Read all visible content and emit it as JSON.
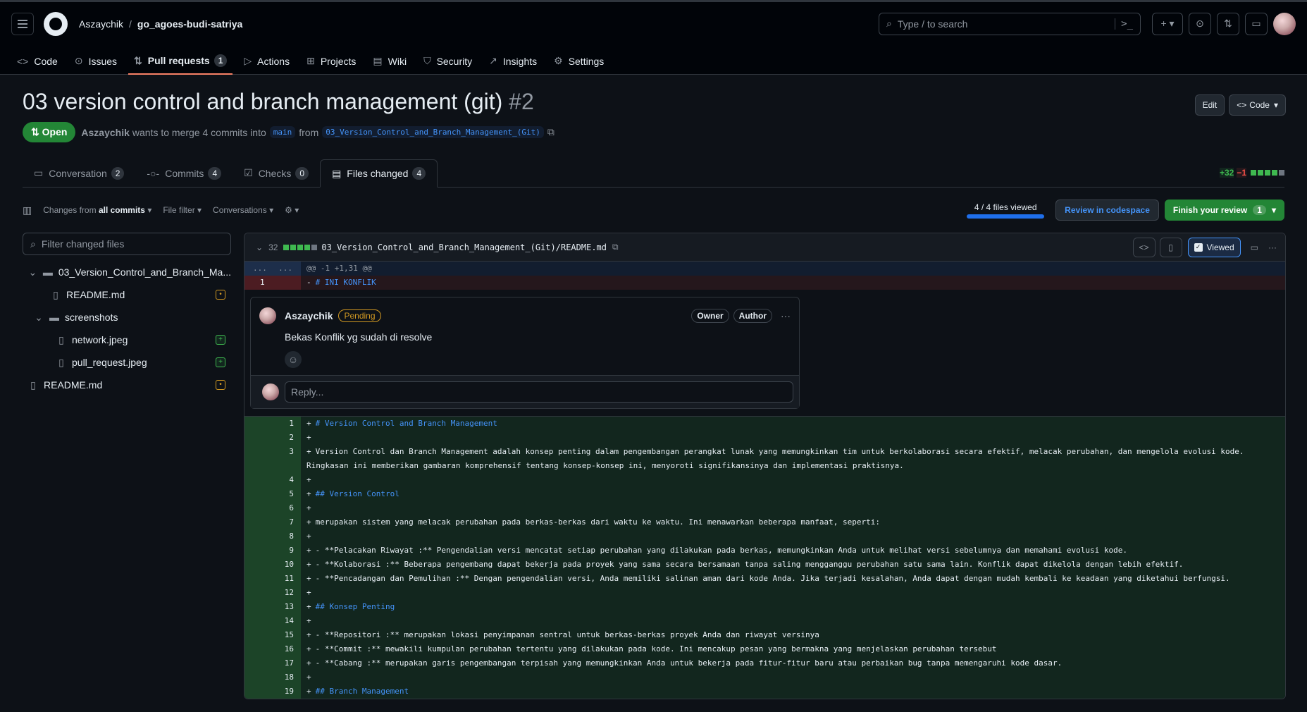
{
  "header": {
    "owner": "Aszaychik",
    "repo": "go_agoes-budi-satriya",
    "search_placeholder": "Type / to search",
    "search_cmd": ">_"
  },
  "repo_tabs": [
    {
      "label": "Code",
      "icon": "<>",
      "count": null
    },
    {
      "label": "Issues",
      "icon": "⊙",
      "count": null
    },
    {
      "label": "Pull requests",
      "icon": "⇅",
      "count": "1"
    },
    {
      "label": "Actions",
      "icon": "▷",
      "count": null
    },
    {
      "label": "Projects",
      "icon": "⊞",
      "count": null
    },
    {
      "label": "Wiki",
      "icon": "▤",
      "count": null
    },
    {
      "label": "Security",
      "icon": "⛉",
      "count": null
    },
    {
      "label": "Insights",
      "icon": "↗",
      "count": null
    },
    {
      "label": "Settings",
      "icon": "⚙",
      "count": null
    }
  ],
  "pr": {
    "title": "03 version control and branch management (git)",
    "number": "#2",
    "state": "Open",
    "author": "Aszaychik",
    "merge_text": "wants to merge 4 commits into",
    "base": "main",
    "from_text": "from",
    "head": "03_Version_Control_and_Branch_Management_(Git)",
    "edit_label": "Edit",
    "code_label": "Code"
  },
  "pr_tabs": [
    {
      "label": "Conversation",
      "count": "2"
    },
    {
      "label": "Commits",
      "count": "4"
    },
    {
      "label": "Checks",
      "count": "0"
    },
    {
      "label": "Files changed",
      "count": "4"
    }
  ],
  "diffstat": {
    "additions": "+32",
    "deletions": "−1"
  },
  "toolbar": {
    "changes_prefix": "Changes from",
    "changes_value": "all commits",
    "file_filter": "File filter",
    "conversations": "Conversations",
    "viewed": "4 / 4 files viewed",
    "review_codespace": "Review in codespace",
    "finish_review": "Finish your review",
    "finish_count": "1"
  },
  "sidebar": {
    "filter_placeholder": "Filter changed files",
    "tree": [
      {
        "name": "03_Version_Control_and_Branch_Ma...",
        "type": "folder",
        "status": null
      },
      {
        "name": "README.md",
        "type": "file",
        "status": "modified"
      },
      {
        "name": "screenshots",
        "type": "folder",
        "status": null
      },
      {
        "name": "network.jpeg",
        "type": "file",
        "status": "added"
      },
      {
        "name": "pull_request.jpeg",
        "type": "file",
        "status": "added"
      },
      {
        "name": "README.md",
        "type": "file",
        "status": "modified"
      }
    ]
  },
  "file": {
    "changes": "32",
    "path": "03_Version_Control_and_Branch_Management_(Git)/README.md",
    "viewed_label": "Viewed",
    "hunk_left": "...",
    "hunk_right": "...",
    "hunk": "@@ -1 +1,31 @@",
    "deleted_line_num": "1",
    "deleted_line": "# INI KONFLIK"
  },
  "comment": {
    "author": "Aszaychik",
    "badge": "Pending",
    "owner_label": "Owner",
    "author_label": "Author",
    "text": "Bekas Konflik yg sudah di resolve",
    "reply_placeholder": "Reply..."
  },
  "added_lines": [
    {
      "n": "1",
      "text": "# Version Control and Branch Management",
      "heading": true
    },
    {
      "n": "2",
      "text": "",
      "heading": false
    },
    {
      "n": "3",
      "text": "Version Control dan Branch Management adalah konsep penting dalam pengembangan perangkat lunak yang memungkinkan tim untuk berkolaborasi secara efektif, melacak perubahan, dan mengelola evolusi kode. Ringkasan ini memberikan gambaran komprehensif tentang konsep-konsep ini, menyoroti signifikansinya dan implementasi praktisnya.",
      "heading": false
    },
    {
      "n": "4",
      "text": "",
      "heading": false
    },
    {
      "n": "5",
      "text": "## Version Control",
      "heading": true
    },
    {
      "n": "6",
      "text": "",
      "heading": false
    },
    {
      "n": "7",
      "text": "merupakan sistem yang melacak perubahan pada berkas-berkas dari waktu ke waktu. Ini menawarkan beberapa manfaat, seperti:",
      "heading": false
    },
    {
      "n": "8",
      "text": "",
      "heading": false
    },
    {
      "n": "9",
      "text": "- **Pelacakan Riwayat :** Pengendalian versi mencatat setiap perubahan yang dilakukan pada berkas, memungkinkan Anda untuk melihat versi sebelumnya dan memahami evolusi kode.",
      "heading": false
    },
    {
      "n": "10",
      "text": "- **Kolaborasi :** Beberapa pengembang dapat bekerja pada proyek yang sama secara bersamaan tanpa saling mengganggu perubahan satu sama lain. Konflik dapat dikelola dengan lebih efektif.",
      "heading": false
    },
    {
      "n": "11",
      "text": "- **Pencadangan dan Pemulihan :** Dengan pengendalian versi, Anda memiliki salinan aman dari kode Anda. Jika terjadi kesalahan, Anda dapat dengan mudah kembali ke keadaan yang diketahui berfungsi.",
      "heading": false
    },
    {
      "n": "12",
      "text": "",
      "heading": false
    },
    {
      "n": "13",
      "text": "## Konsep Penting",
      "heading": true
    },
    {
      "n": "14",
      "text": "",
      "heading": false
    },
    {
      "n": "15",
      "text": "- **Repositori :** merupakan lokasi penyimpanan sentral untuk berkas-berkas proyek Anda dan riwayat versinya",
      "heading": false
    },
    {
      "n": "16",
      "text": "- **Commit :** mewakili kumpulan perubahan tertentu yang dilakukan pada kode. Ini mencakup pesan yang bermakna yang menjelaskan perubahan tersebut",
      "heading": false
    },
    {
      "n": "17",
      "text": "- **Cabang :** merupakan garis pengembangan terpisah yang memungkinkan Anda untuk bekerja pada fitur-fitur baru atau perbaikan bug tanpa memengaruhi kode dasar.",
      "heading": false
    },
    {
      "n": "18",
      "text": "",
      "heading": false
    },
    {
      "n": "19",
      "text": "## Branch Management",
      "heading": true
    }
  ]
}
